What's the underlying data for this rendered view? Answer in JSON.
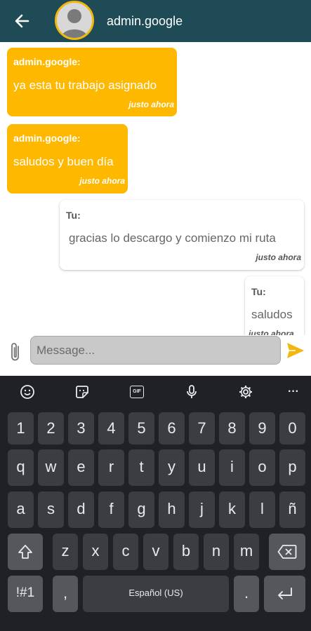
{
  "header": {
    "title": "admin.google",
    "back_icon": "arrow-left-icon",
    "avatar_icon": "default-avatar-icon"
  },
  "messages": [
    {
      "sender": "admin.google:",
      "text": "ya esta tu trabajo asignado",
      "time": "justo ahora",
      "direction": "incoming"
    },
    {
      "sender": "admin.google:",
      "text": "saludos y buen día",
      "time": "justo ahora",
      "direction": "incoming"
    },
    {
      "sender": "Tu:",
      "text": "gracias lo descargo y comienzo mi ruta",
      "time": "justo ahora",
      "direction": "outgoing"
    },
    {
      "sender": "Tu:",
      "text": "saludos",
      "time": "justo ahora",
      "direction": "outgoing"
    }
  ],
  "composer": {
    "placeholder": "Message...",
    "attach_icon": "paperclip-icon",
    "send_icon": "send-icon"
  },
  "keyboard": {
    "toolbar": [
      "emoji-icon",
      "sticker-icon",
      "gif-icon",
      "microphone-icon",
      "settings-icon",
      "more-icon"
    ],
    "gif_label": "GIF",
    "more_label": "···",
    "rows": [
      [
        "1",
        "2",
        "3",
        "4",
        "5",
        "6",
        "7",
        "8",
        "9",
        "0"
      ],
      [
        "q",
        "w",
        "e",
        "r",
        "t",
        "y",
        "u",
        "i",
        "o",
        "p"
      ],
      [
        "a",
        "s",
        "d",
        "f",
        "g",
        "h",
        "j",
        "k",
        "l",
        "ñ"
      ],
      [
        "z",
        "x",
        "c",
        "v",
        "b",
        "n",
        "m"
      ]
    ],
    "symbols_label": "!#1",
    "comma_label": ",",
    "space_label": "Español (US)",
    "period_label": "."
  },
  "colors": {
    "header": "#1e4b55",
    "incoming_bubble": "#ffb800",
    "accent": "#f2b70c",
    "keyboard_bg": "#202124"
  }
}
